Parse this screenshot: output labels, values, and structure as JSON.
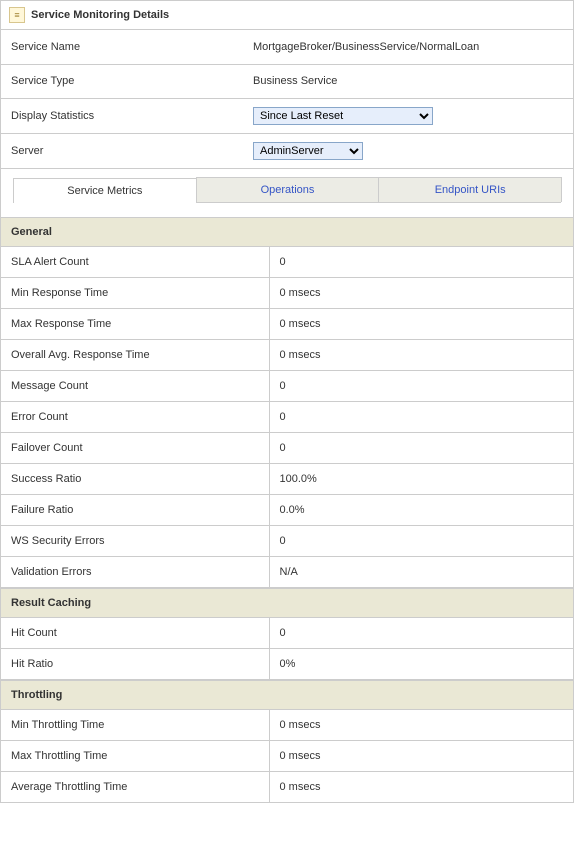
{
  "header": {
    "title": "Service Monitoring Details"
  },
  "info": {
    "service_name_label": "Service Name",
    "service_name_value": "MortgageBroker/BusinessService/NormalLoan",
    "service_type_label": "Service Type",
    "service_type_value": "Business Service",
    "display_stats_label": "Display Statistics",
    "display_stats_selected": "Since Last Reset",
    "server_label": "Server",
    "server_selected": "AdminServer"
  },
  "tabs": {
    "service_metrics": "Service Metrics",
    "operations": "Operations",
    "endpoint_uris": "Endpoint URIs"
  },
  "sections": {
    "general": {
      "title": "General",
      "rows": [
        {
          "label": "SLA Alert Count",
          "value": "0"
        },
        {
          "label": "Min Response Time",
          "value": "0 msecs"
        },
        {
          "label": "Max Response Time",
          "value": "0 msecs"
        },
        {
          "label": "Overall Avg. Response Time",
          "value": "0 msecs"
        },
        {
          "label": "Message Count",
          "value": "0"
        },
        {
          "label": "Error Count",
          "value": "0"
        },
        {
          "label": "Failover Count",
          "value": "0"
        },
        {
          "label": "Success Ratio",
          "value": "100.0%"
        },
        {
          "label": "Failure Ratio",
          "value": "0.0%"
        },
        {
          "label": "WS Security Errors",
          "value": "0"
        },
        {
          "label": "Validation Errors",
          "value": "N/A"
        }
      ]
    },
    "result_caching": {
      "title": "Result Caching",
      "rows": [
        {
          "label": "Hit Count",
          "value": "0"
        },
        {
          "label": "Hit Ratio",
          "value": "0%"
        }
      ]
    },
    "throttling": {
      "title": "Throttling",
      "rows": [
        {
          "label": "Min Throttling Time",
          "value": "0 msecs"
        },
        {
          "label": "Max Throttling Time",
          "value": "0 msecs"
        },
        {
          "label": "Average Throttling Time",
          "value": "0 msecs"
        }
      ]
    }
  }
}
